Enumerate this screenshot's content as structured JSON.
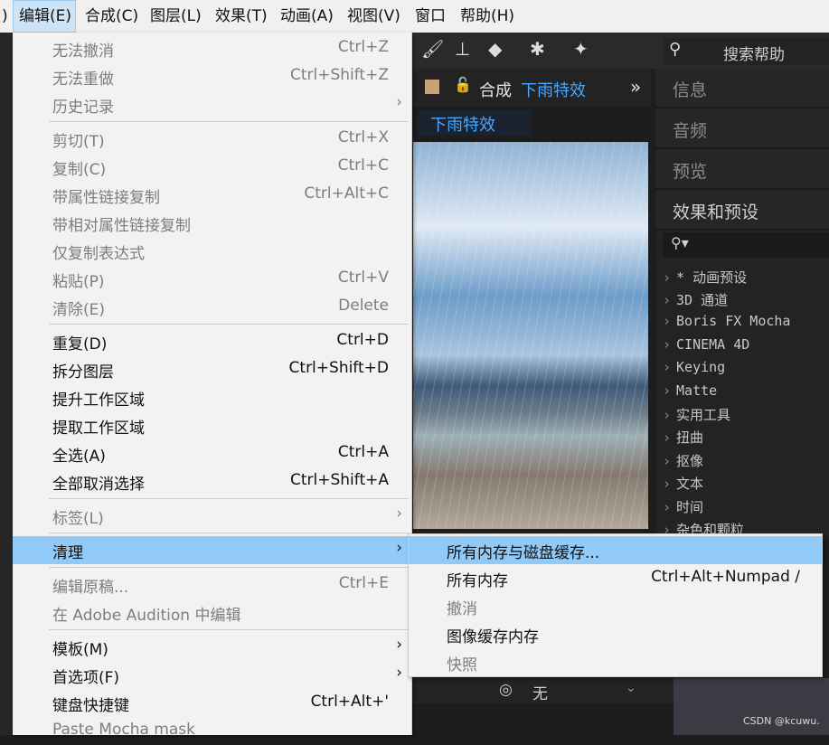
{
  "menubar": {
    "items": [
      {
        "label": ")"
      },
      {
        "label": "编辑(E)"
      },
      {
        "label": "合成(C)"
      },
      {
        "label": "图层(L)"
      },
      {
        "label": "效果(T)"
      },
      {
        "label": "动画(A)"
      },
      {
        "label": "视图(V)"
      },
      {
        "label": "窗口"
      },
      {
        "label": "帮助(H)"
      }
    ]
  },
  "toolbar": {
    "search_placeholder": "搜索帮助"
  },
  "composition": {
    "tab_prefix": "合成",
    "tab_name": "下雨特效",
    "sub_tab": "下雨特效",
    "more_glyph": "»"
  },
  "right_panel": {
    "headers": [
      "信息",
      "音频",
      "预览",
      "效果和预设"
    ],
    "effects": [
      "* 动画预设",
      "3D 通道",
      "Boris FX Mocha",
      "CINEMA 4D",
      "Keying",
      "Matte",
      "实用工具",
      "扭曲",
      "抠像",
      "文本",
      "时间",
      "杂色和颗粒"
    ]
  },
  "bottom": {
    "dropdown_value": "无",
    "watermark": "CSDN @kcuwu."
  },
  "edit_menu": {
    "items": [
      {
        "label": "无法撤消",
        "shortcut": "Ctrl+Z",
        "enabled": false
      },
      {
        "label": "无法重做",
        "shortcut": "Ctrl+Shift+Z",
        "enabled": false
      },
      {
        "label": "历史记录",
        "shortcut": "›",
        "enabled": false
      },
      {
        "label": "剪切(T)",
        "shortcut": "Ctrl+X",
        "enabled": false
      },
      {
        "label": "复制(C)",
        "shortcut": "Ctrl+C",
        "enabled": false
      },
      {
        "label": "带属性链接复制",
        "shortcut": "Ctrl+Alt+C",
        "enabled": false
      },
      {
        "label": "带相对属性链接复制",
        "shortcut": "",
        "enabled": false
      },
      {
        "label": "仅复制表达式",
        "shortcut": "",
        "enabled": false
      },
      {
        "label": "粘贴(P)",
        "shortcut": "Ctrl+V",
        "enabled": false
      },
      {
        "label": "清除(E)",
        "shortcut": "Delete",
        "enabled": false
      },
      {
        "label": "重复(D)",
        "shortcut": "Ctrl+D",
        "enabled": true
      },
      {
        "label": "拆分图层",
        "shortcut": "Ctrl+Shift+D",
        "enabled": true
      },
      {
        "label": "提升工作区域",
        "shortcut": "",
        "enabled": true
      },
      {
        "label": "提取工作区域",
        "shortcut": "",
        "enabled": true
      },
      {
        "label": "全选(A)",
        "shortcut": "Ctrl+A",
        "enabled": true
      },
      {
        "label": "全部取消选择",
        "shortcut": "Ctrl+Shift+A",
        "enabled": true
      },
      {
        "label": "标签(L)",
        "shortcut": "›",
        "enabled": false
      },
      {
        "label": "清理",
        "shortcut": "›",
        "enabled": true
      },
      {
        "label": "编辑原稿...",
        "shortcut": "Ctrl+E",
        "enabled": false
      },
      {
        "label": "在 Adobe Audition 中编辑",
        "shortcut": "",
        "enabled": false
      },
      {
        "label": "模板(M)",
        "shortcut": "›",
        "enabled": true
      },
      {
        "label": "首选项(F)",
        "shortcut": "›",
        "enabled": true
      },
      {
        "label": "键盘快捷键",
        "shortcut": "Ctrl+Alt+'",
        "enabled": true
      },
      {
        "label": "Paste Mocha mask",
        "shortcut": "",
        "enabled": false
      }
    ]
  },
  "purge_submenu": {
    "items": [
      {
        "label": "所有内存与磁盘缓存...",
        "shortcut": "",
        "enabled": true
      },
      {
        "label": "所有内存",
        "shortcut": "Ctrl+Alt+Numpad /",
        "enabled": true
      },
      {
        "label": "撤消",
        "shortcut": "",
        "enabled": false
      },
      {
        "label": "图像缓存内存",
        "shortcut": "",
        "enabled": true
      },
      {
        "label": "快照",
        "shortcut": "",
        "enabled": false
      }
    ]
  }
}
